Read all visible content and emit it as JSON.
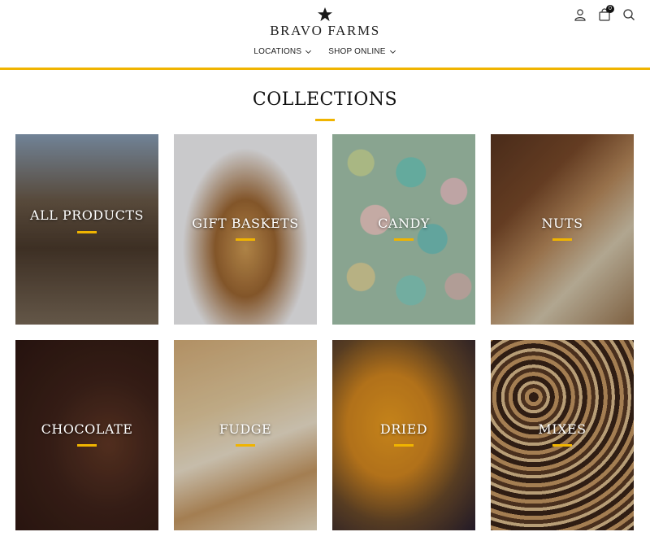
{
  "brand": {
    "name": "BRAVO FARMS"
  },
  "nav": [
    {
      "label": "LOCATIONS"
    },
    {
      "label": "SHOP ONLINE"
    }
  ],
  "header_icons": {
    "account": "account-icon",
    "cart": "cart-icon",
    "cart_count": "0",
    "search": "search-icon"
  },
  "collections": {
    "title": "COLLECTIONS",
    "items": [
      {
        "label": "ALL PRODUCTS"
      },
      {
        "label": "GIFT BASKETS"
      },
      {
        "label": "CANDY"
      },
      {
        "label": "NUTS"
      },
      {
        "label": "CHOCOLATE"
      },
      {
        "label": "FUDGE"
      },
      {
        "label": "DRIED"
      },
      {
        "label": "MIXES"
      }
    ]
  },
  "colors": {
    "accent": "#f0b400"
  }
}
